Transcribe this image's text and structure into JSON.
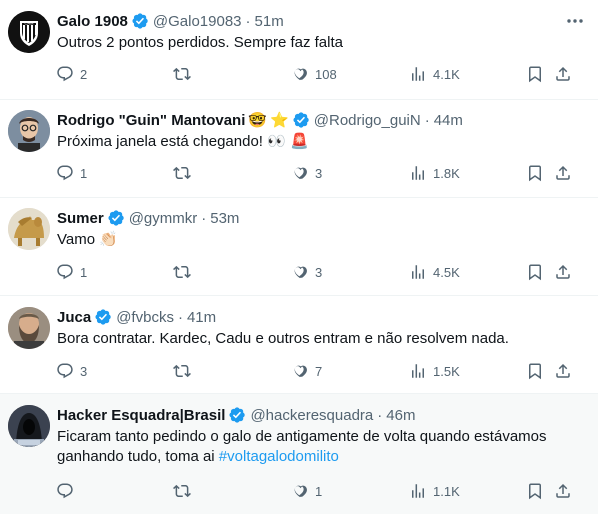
{
  "tweets": [
    {
      "name": "Galo 1908",
      "badges": [],
      "handle": "@Galo19083",
      "time": "51m",
      "text": "Outros 2 pontos perdidos. Sempre faz falta",
      "hashtag": "",
      "replies": "2",
      "retweets": "",
      "likes": "108",
      "views": "4.1K",
      "avatar": "atletico-mineiro-crest"
    },
    {
      "name": "Rodrigo \"Guin\" Mantovani",
      "badges": [
        "🤓",
        "⭐"
      ],
      "handle": "@Rodrigo_guiN",
      "time": "44m",
      "text": "Próxima janela está chegando! 👀 🚨",
      "hashtag": "",
      "replies": "1",
      "retweets": "",
      "likes": "3",
      "views": "1.8K",
      "avatar": "caricature-man"
    },
    {
      "name": "Sumer",
      "badges": [],
      "handle": "@gymmkr",
      "time": "53m",
      "text": "Vamo 👏🏻",
      "hashtag": "",
      "replies": "1",
      "retweets": "",
      "likes": "3",
      "views": "4.5K",
      "avatar": "lamassu-statue"
    },
    {
      "name": "Juca",
      "badges": [],
      "handle": "@fvbcks",
      "time": "41m",
      "text": "Bora contratar. Kardec, Cadu e outros entram e não resolvem nada.",
      "hashtag": "",
      "replies": "3",
      "retweets": "",
      "likes": "7",
      "views": "1.5K",
      "avatar": "bearded-man-photo"
    },
    {
      "name": "Hacker Esquadra|Brasil",
      "badges": [],
      "handle": "@hackeresquadra",
      "time": "46m",
      "text": "Ficaram tanto pedindo o galo de antigamente de volta quando estávamos ganhando tudo, toma ai ",
      "hashtag": "#voltagalodomilito",
      "replies": "",
      "retweets": "",
      "likes": "1",
      "views": "1.1K",
      "avatar": "hooded-hacker"
    }
  ],
  "colors": {
    "accent": "#1d9bf0",
    "muted": "#536471",
    "text": "#0f1419",
    "highlight_bg": "#f7f9f9"
  }
}
